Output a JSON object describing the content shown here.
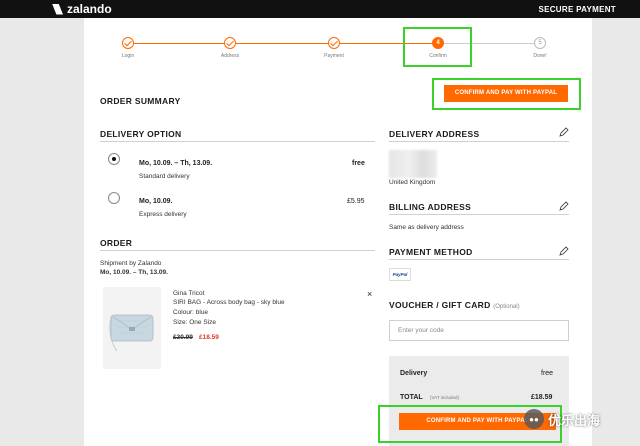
{
  "header": {
    "logo": "zalando",
    "secure": "SECURE PAYMENT"
  },
  "progress": {
    "steps": [
      {
        "label": "Login",
        "state": "done"
      },
      {
        "label": "Address",
        "state": "done"
      },
      {
        "label": "Payment",
        "state": "done"
      },
      {
        "label": "Confirm",
        "state": "current",
        "number": "4"
      },
      {
        "label": "Done!",
        "state": "future",
        "number": "5"
      }
    ]
  },
  "order_summary": {
    "title": "ORDER SUMMARY",
    "confirm_label": "CONFIRM AND PAY WITH PAYPAL"
  },
  "delivery_option": {
    "title": "DELIVERY OPTION",
    "options": [
      {
        "dates": "Mo, 10.09. – Th, 13.09.",
        "name": "Standard delivery",
        "price": "free",
        "selected": true
      },
      {
        "dates": "Mo, 10.09.",
        "name": "Express delivery",
        "price": "£5.95",
        "selected": false
      }
    ]
  },
  "order": {
    "title": "ORDER",
    "shipment": "Shipment by Zalando",
    "shipment_dates": "Mo, 10.09. – Th, 13.09.",
    "item": {
      "brand": "Gina Tricot",
      "name": "SIRI BAG - Across body bag - sky blue",
      "colour": "Colour: blue",
      "size": "Size: One Size",
      "old_price": "£30.99",
      "price": "£18.59"
    },
    "remove_icon": "×"
  },
  "delivery_address": {
    "title": "DELIVERY ADDRESS",
    "country": "United Kingdom"
  },
  "billing_address": {
    "title": "BILLING ADDRESS",
    "text": "Same as delivery address"
  },
  "payment_method": {
    "title": "PAYMENT METHOD",
    "badge": "PayPal"
  },
  "voucher": {
    "title": "VOUCHER / GIFT CARD",
    "optional": "(Optional)",
    "placeholder": "Enter your code"
  },
  "totals": {
    "delivery_label": "Delivery",
    "delivery_value": "free",
    "total_label": "TOTAL",
    "vat_note": "(VAT included)",
    "total_value": "£18.59",
    "confirm_label": "CONFIRM AND PAY WITH PAYPAL"
  },
  "watermark": {
    "text": "优乐出海",
    "icon": "wechat-icon"
  },
  "colors": {
    "accent": "#ff6900",
    "highlight": "#3ad12a",
    "header": "#111111"
  }
}
